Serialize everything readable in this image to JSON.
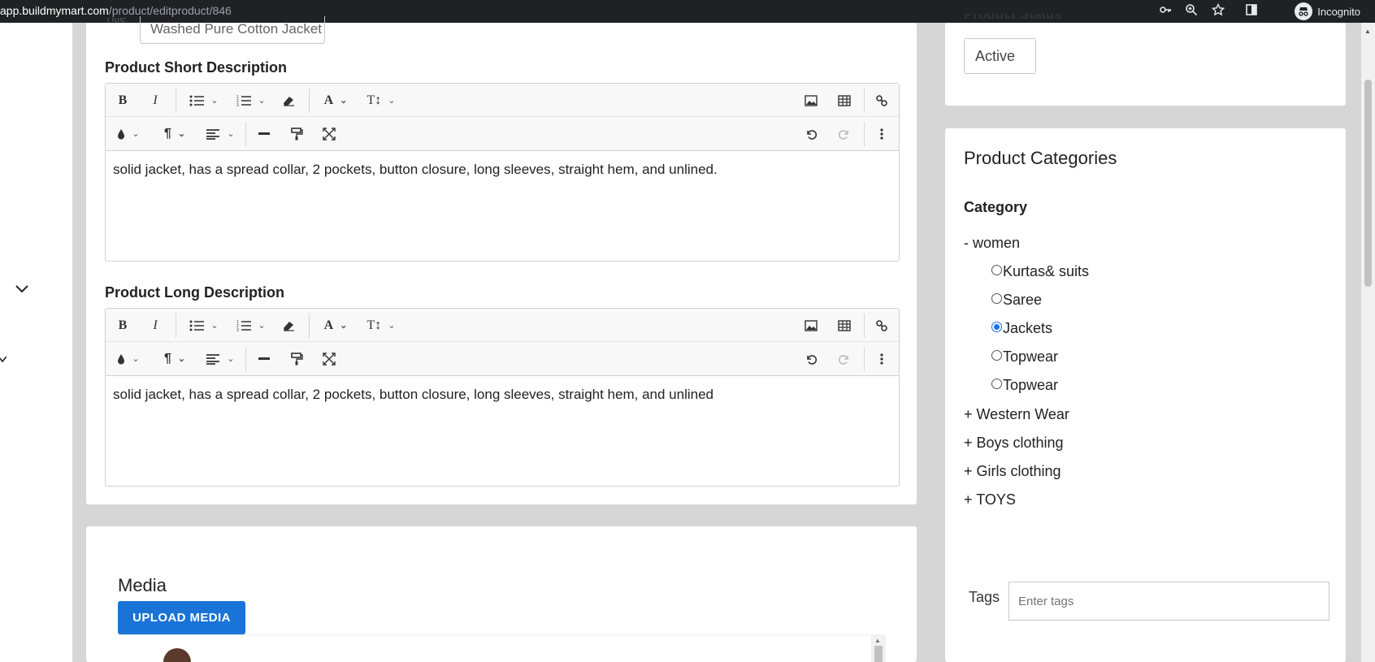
{
  "browser": {
    "url_host": "app.buildmymart.com",
    "url_path": "/product/editproduct/846",
    "incognito_label": "Incognito",
    "icons": [
      "key-icon",
      "zoom-icon",
      "star-icon",
      "sidepanel-icon",
      "incognito-icon"
    ]
  },
  "sidebar": {
    "chevron_1": "⌄",
    "chevron_2": "⌄"
  },
  "product": {
    "title_label": "Title",
    "title_value": "Washed Pure Cotton Jacket"
  },
  "short_description": {
    "label": "Product Short Description",
    "content": "solid jacket, has a spread collar, 2 pockets, button closure, long sleeves, straight hem, and unlined."
  },
  "long_description": {
    "label": "Product Long Description",
    "content": "solid jacket, has a spread collar, 2 pockets, button closure, long sleeves, straight hem, and unlined"
  },
  "toolbar": {
    "bold": "B",
    "italic": "I",
    "font": "A",
    "font_size": "T↕",
    "paragraph": "¶",
    "color": "●",
    "hr": "━",
    "undo": "↺",
    "redo": "↻",
    "more": "⋮",
    "caret": "⌄"
  },
  "media": {
    "title": "Media",
    "upload_label": "UPLOAD MEDIA"
  },
  "status": {
    "label": "Product Status",
    "value": "Active"
  },
  "categories": {
    "title": "Product Categories",
    "category_label": "Category",
    "root": "- women",
    "women_children": [
      {
        "label": "Kurtas& suits",
        "checked": false
      },
      {
        "label": "Saree",
        "checked": false
      },
      {
        "label": "Jackets",
        "checked": true
      },
      {
        "label": "Topwear",
        "checked": false
      },
      {
        "label": "Topwear",
        "checked": false
      }
    ],
    "collapsed": [
      "+ Western Wear",
      "+ Boys clothing",
      "+ Girls clothing",
      "+ TOYS"
    ]
  },
  "tags": {
    "label": "Tags",
    "placeholder": "Enter tags"
  },
  "colors": {
    "accent": "#1a73d6",
    "page_bg": "#d6d6d6",
    "browser_bar": "#202124"
  }
}
